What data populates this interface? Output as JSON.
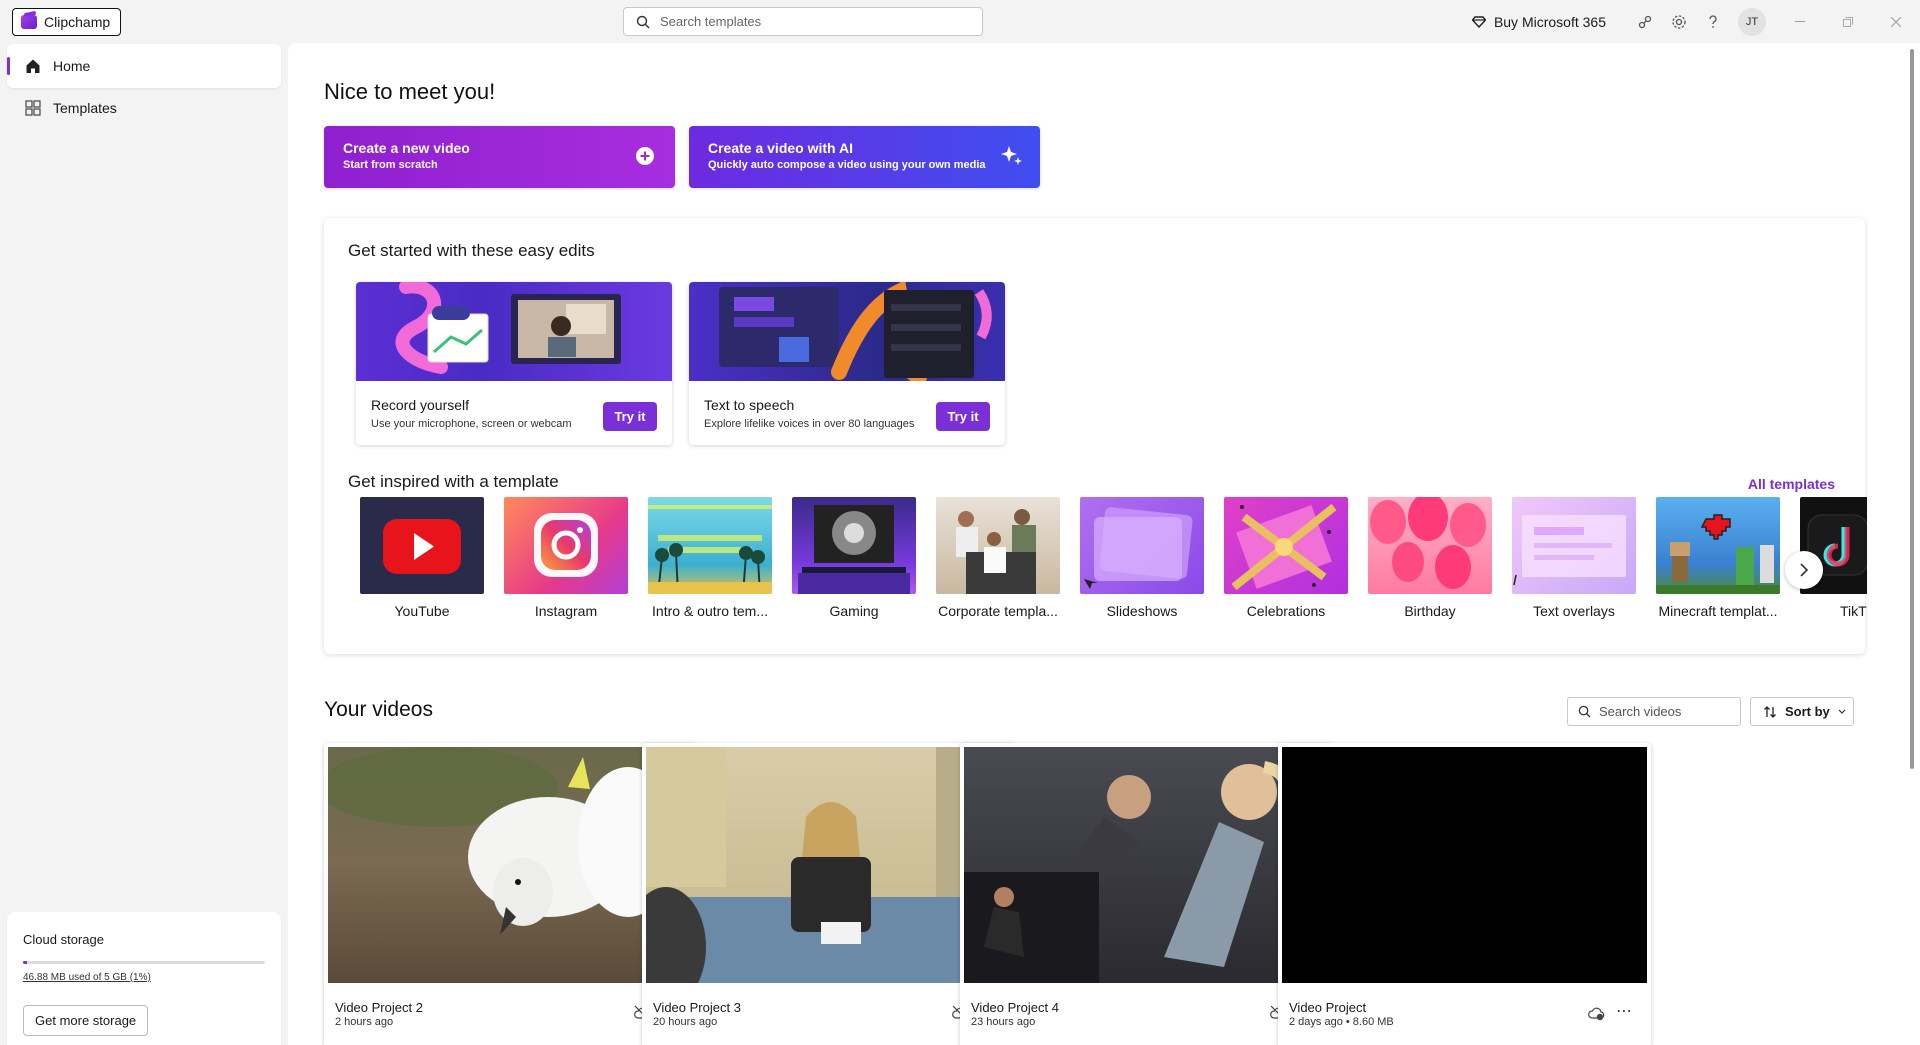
{
  "app": {
    "name": "Clipchamp",
    "search_placeholder": "Search templates",
    "buy_label": "Buy Microsoft 365",
    "avatar_initials": "JT",
    "accent_color": "#7b2fd6"
  },
  "sidebar": {
    "items": [
      {
        "label": "Home",
        "icon": "home-icon",
        "active": true
      },
      {
        "label": "Templates",
        "icon": "templates-icon",
        "active": false
      }
    ],
    "storage": {
      "title": "Cloud storage",
      "usage_text": "46.88 MB used of 5 GB (1%)",
      "usage_fraction": 0.01,
      "button": "Get more storage"
    }
  },
  "main": {
    "greeting": "Nice to meet you!",
    "cta_new": {
      "title": "Create a new video",
      "subtitle": "Start from scratch"
    },
    "cta_ai": {
      "title": "Create a video with AI",
      "subtitle": "Quickly auto compose a video using your own media"
    },
    "easy_edits": {
      "title": "Get started with these easy edits",
      "cards": [
        {
          "name": "Record yourself",
          "desc": "Use your microphone, screen or webcam",
          "button": "Try it"
        },
        {
          "name": "Text to speech",
          "desc": "Explore lifelike voices in over 80 languages",
          "button": "Try it"
        }
      ]
    },
    "templates": {
      "title": "Get inspired with a template",
      "all_link": "All templates",
      "items": [
        {
          "label": "YouTube"
        },
        {
          "label": "Instagram"
        },
        {
          "label": "Intro & outro tem..."
        },
        {
          "label": "Gaming"
        },
        {
          "label": "Corporate templa..."
        },
        {
          "label": "Slideshows"
        },
        {
          "label": "Celebrations"
        },
        {
          "label": "Birthday"
        },
        {
          "label": "Text overlays"
        },
        {
          "label": "Minecraft templat..."
        },
        {
          "label": "TikT"
        }
      ]
    },
    "videos": {
      "title": "Your videos",
      "search_placeholder": "Search videos",
      "sort_label": "Sort by",
      "items": [
        {
          "name": "Video Project 2",
          "meta": "2 hours ago"
        },
        {
          "name": "Video Project 3",
          "meta": "20 hours ago"
        },
        {
          "name": "Video Project 4",
          "meta": "23 hours ago"
        },
        {
          "name": "Video Project",
          "meta": "2 days ago • 8.60 MB"
        }
      ]
    }
  }
}
